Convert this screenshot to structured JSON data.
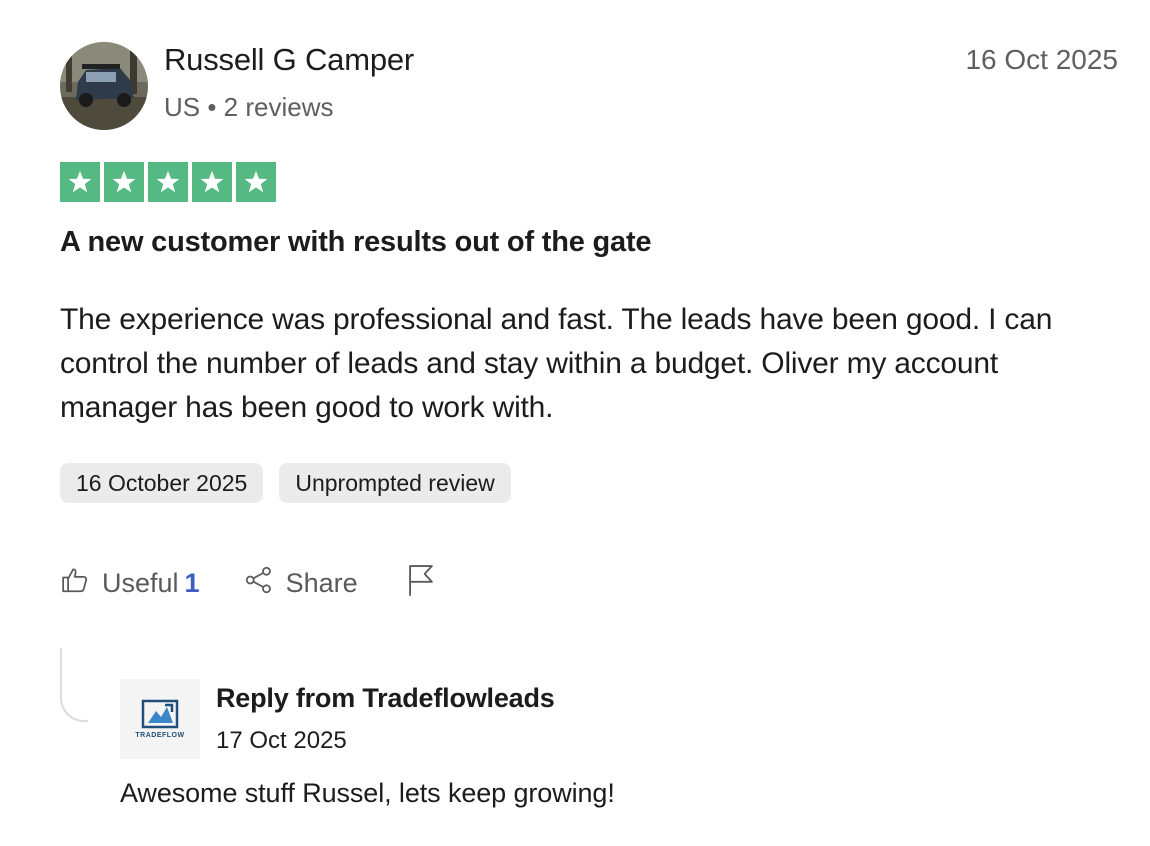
{
  "reviewer": {
    "name": "Russell G Camper",
    "meta": "US • 2 reviews",
    "date": "16 Oct 2025"
  },
  "rating": {
    "stars": 5,
    "max": 5,
    "color": "#54b982"
  },
  "review": {
    "title": "A new customer with results out of the gate",
    "body": "The experience was professional and fast. The leads have been good. I can control the number of leads and stay within a budget. Oliver my account manager has been good to work with."
  },
  "tags": {
    "date": "16 October 2025",
    "type": "Unprompted review"
  },
  "actions": {
    "useful_label": "Useful",
    "useful_count": "1",
    "share_label": "Share",
    "useful_icon": "thumbs-up-icon",
    "share_icon": "share-icon",
    "flag_icon": "flag-icon"
  },
  "reply": {
    "title": "Reply from Tradeflowleads",
    "date": "17 Oct 2025",
    "body": "Awesome stuff Russel, lets keep growing!",
    "logo_text": "TRADEFLOW"
  },
  "colors": {
    "useful_count": "#3c5ec2",
    "tag_bg": "#ebebeb",
    "muted_text": "#5f5f5f"
  }
}
